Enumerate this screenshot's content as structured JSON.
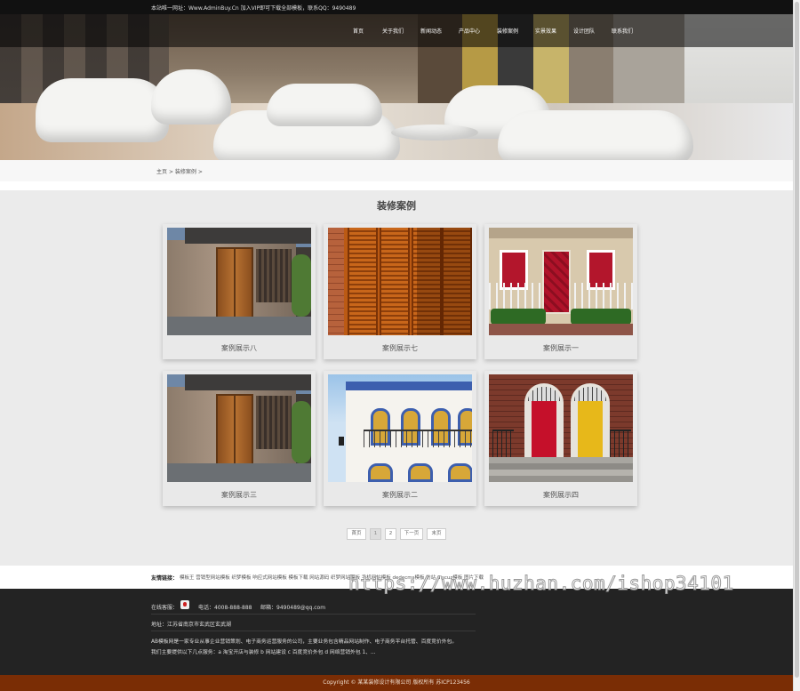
{
  "topbar": {
    "notice": "本站唯一网址：Www.AdminBuy.Cn 加入VIP即可下载全部模板，联系QQ：9490489"
  },
  "nav": {
    "items": [
      "首页",
      "关于我们",
      "新闻动态",
      "产品中心",
      "装修案例",
      "实景效果",
      "设计团队",
      "联系我们"
    ]
  },
  "breadcrumb": {
    "home": "主页",
    "sep": ">",
    "current": "装修案例",
    "tail": ">"
  },
  "section": {
    "title": "装修案例"
  },
  "cases": [
    {
      "caption": "案例展示八",
      "image": "wooden-door-cabin"
    },
    {
      "caption": "案例展示七",
      "image": "orange-shutters"
    },
    {
      "caption": "案例展示一",
      "image": "red-door-brick-house"
    },
    {
      "caption": "案例展示三",
      "image": "wooden-door-cabin"
    },
    {
      "caption": "案例展示二",
      "image": "colonial-balcony-house"
    },
    {
      "caption": "案例展示四",
      "image": "red-yellow-doors"
    }
  ],
  "pager": {
    "first": "首页",
    "p1": "1",
    "p2": "2",
    "next": "下一页",
    "last": "末页"
  },
  "links": {
    "label": "友情链接：",
    "items": "模板王 营销型网站模板 织梦模板 响应式网站模板 模板下载 网站源码 织梦网站模板 手机网站模板 dedecms模板 仿站 discuz模板 图片下载"
  },
  "footer": {
    "service": "在线客服：",
    "tel": "电话：4008-888-888",
    "email": "邮箱：9490489@qq.com",
    "address": "地址：江苏省南京市玄武区玄武湖",
    "desc1": "AB模板网是一家专业从事企业营销策划、电子商务运营服务的公司，主要业务包含精品网站制作、电子商务平台托管、百度竞价外包。",
    "desc2": "我们主要提供以下几点服务：a 淘宝开店与装修 b 网站建设 c 百度竞价外包 d 网络营销外包 1、..."
  },
  "copyright": "Copyright © 某某装修设计有限公司 版权所有   苏ICP123456",
  "watermark": "https://www.huzhan.com/ishop34101"
}
